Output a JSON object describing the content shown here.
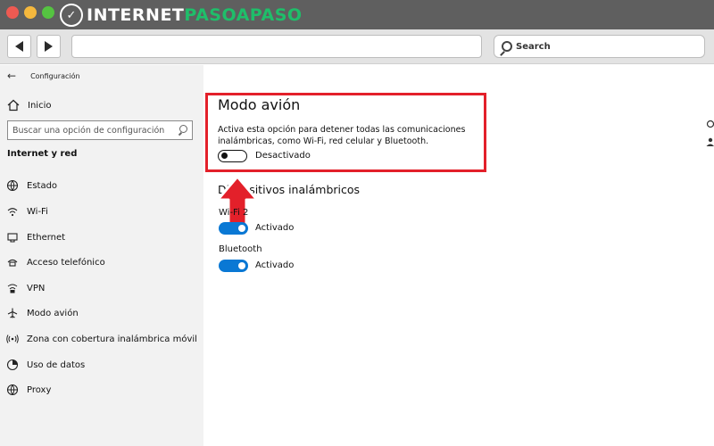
{
  "browser": {
    "logo_text_prefix": "INTERNET",
    "logo_text_accent": "PASOAPASO",
    "search_placeholder": "Search"
  },
  "sidebar": {
    "title": "Configuración",
    "home": "Inicio",
    "search_placeholder": "Buscar una opción de configuración",
    "section": "Internet y red",
    "items": [
      {
        "label": "Estado",
        "icon": "globe-status-icon"
      },
      {
        "label": "Wi-Fi",
        "icon": "wifi-icon"
      },
      {
        "label": "Ethernet",
        "icon": "ethernet-icon"
      },
      {
        "label": "Acceso telefónico",
        "icon": "dialup-icon"
      },
      {
        "label": "VPN",
        "icon": "vpn-icon"
      },
      {
        "label": "Modo avión",
        "icon": "airplane-icon"
      },
      {
        "label": "Zona con cobertura inalámbrica móvil",
        "icon": "hotspot-icon"
      },
      {
        "label": "Uso de datos",
        "icon": "data-usage-icon"
      },
      {
        "label": "Proxy",
        "icon": "globe-proxy-icon"
      }
    ]
  },
  "main": {
    "title": "Modo avión",
    "description": "Activa esta opción para detener todas las comunicaciones inalámbricas, como Wi-Fi, red celular y Bluetooth.",
    "airplane_toggle_label": "Desactivado",
    "airplane_toggle_on": false,
    "devices_title": "Dispositivos inalámbricos",
    "devices": [
      {
        "name": "Wi-Fi 2",
        "state": "Activado",
        "on": true
      },
      {
        "name": "Bluetooth",
        "state": "Activado",
        "on": true
      }
    ]
  },
  "colors": {
    "accent_blue": "#0a78d4",
    "highlight_red": "#e3202a",
    "logo_green": "#1fbe6a"
  }
}
